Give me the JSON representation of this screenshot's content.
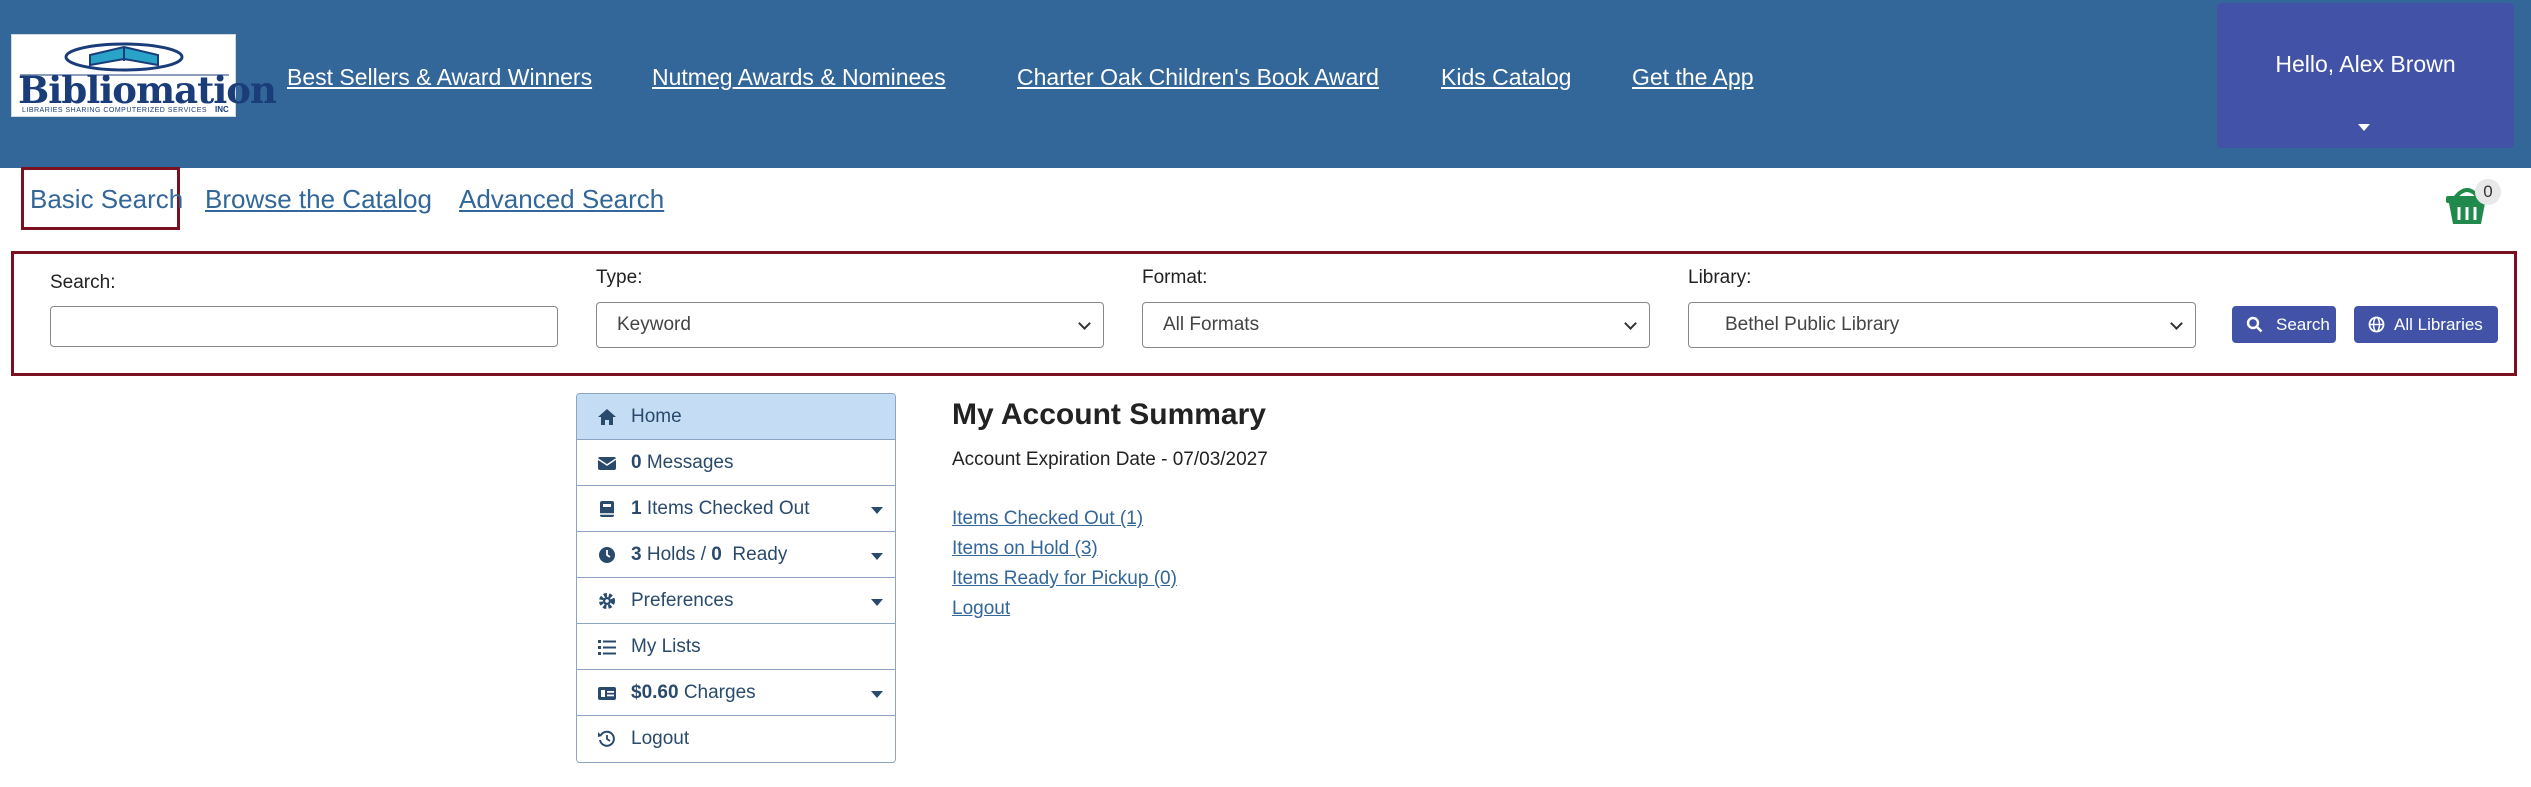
{
  "header": {
    "logo": {
      "name": "Bibliomation",
      "tagline": "LIBRARIES SHARING COMPUTERIZED SERVICES",
      "suffix": "INC"
    },
    "nav_links": [
      {
        "label": "Best Sellers & Award Winners"
      },
      {
        "label": "Nutmeg Awards & Nominees"
      },
      {
        "label": "Charter Oak Children's Book Award"
      },
      {
        "label": "Kids Catalog"
      },
      {
        "label": "Get the App"
      }
    ],
    "user_menu": {
      "greeting": "Hello, Alex Brown"
    }
  },
  "search_tabs": {
    "items": [
      {
        "label": "Basic Search",
        "active": true
      },
      {
        "label": "Browse the Catalog",
        "active": false
      },
      {
        "label": "Advanced Search",
        "active": false
      }
    ],
    "basket_count": "0"
  },
  "search_form": {
    "search_label": "Search:",
    "search_value": "",
    "type_label": "Type:",
    "type_value": "Keyword",
    "format_label": "Format:",
    "format_value": "All Formats",
    "library_label": "Library:",
    "library_value": "Bethel Public Library",
    "search_button": "Search",
    "all_libraries_button": "All Libraries"
  },
  "sidebar": {
    "items": [
      {
        "label": "Home",
        "count": "",
        "icon": "home-icon",
        "active": true,
        "dropdown": false
      },
      {
        "label": "Messages",
        "count": "0",
        "icon": "envelope-icon",
        "active": false,
        "dropdown": false
      },
      {
        "label": "Items Checked Out",
        "count": "1",
        "icon": "book-icon",
        "active": false,
        "dropdown": true
      },
      {
        "label": "Holds / ",
        "count": "3",
        "count2": "0",
        "label2": "Ready",
        "icon": "clock-icon",
        "active": false,
        "dropdown": true
      },
      {
        "label": "Preferences",
        "count": "",
        "icon": "gear-icon",
        "active": false,
        "dropdown": true
      },
      {
        "label": "My Lists",
        "count": "",
        "icon": "list-icon",
        "active": false,
        "dropdown": false
      },
      {
        "label": "Charges",
        "count": "$0.60",
        "icon": "money-icon",
        "active": false,
        "dropdown": true
      },
      {
        "label": "Logout",
        "count": "",
        "icon": "history-icon",
        "active": false,
        "dropdown": false
      }
    ]
  },
  "summary": {
    "title": "My Account Summary",
    "expiration": "Account Expiration Date - 07/03/2027",
    "links": [
      {
        "label": "Items Checked Out (1)"
      },
      {
        "label": "Items on Hold (3)"
      },
      {
        "label": "Items Ready for Pickup (0)"
      },
      {
        "label": "Logout"
      }
    ]
  },
  "colors": {
    "header_bg": "#336699",
    "accent": "#4253a7",
    "highlight_border": "#7a1020",
    "active_menu_bg": "#c5dcf5",
    "basket_green": "#1f8a4c"
  }
}
